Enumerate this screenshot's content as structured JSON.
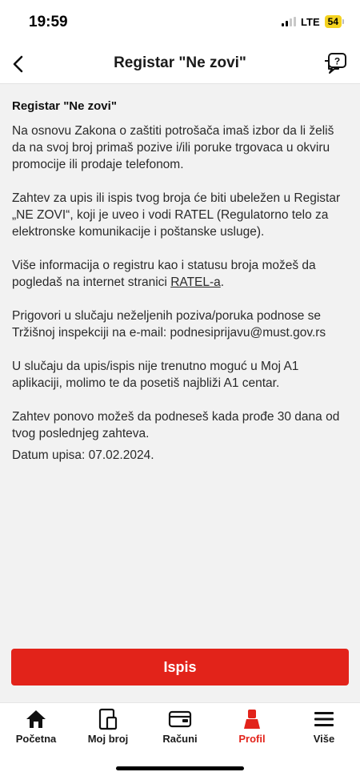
{
  "status_bar": {
    "time": "19:59",
    "network": "LTE",
    "battery": "54"
  },
  "header": {
    "title": "Registar \"Ne zovi\"",
    "back_icon": "chevron-left-icon",
    "help_icon": "help-chat-icon"
  },
  "content": {
    "title": "Registar \"Ne zovi\"",
    "p1": "Na osnovu Zakona o zaštiti potrošača imaš izbor da li želiš da na svoj broj primaš pozive i/ili poruke trgovaca u okviru promocije ili prodaje telefonom.",
    "p2": "Zahtev za upis ili ispis tvog broja će biti ubeležen u Registar „NE ZOVI“, koji je uveo i vodi RATEL (Regulatorno telo za elektronske komunikacije i poštanske usluge).",
    "p3_before": "Više informacija o registru kao i statusu broja možeš da pogledaš na internet stranici ",
    "p3_link": "RATEL-a",
    "p3_after": ".",
    "p4": "Prigovori u slučaju neželjenih poziva/poruka podnose se Tržišnoj inspekciji na e-mail: podnesiprijavu@must.gov.rs",
    "p5": "U slučaju da upis/ispis nije trenutno moguć u Moj A1 aplikaciji, molimo te da posetiš najbliži A1 centar.",
    "p6": "Zahtev ponovo možeš da podneseš kada prođe 30 dana od tvog poslednjeg zahteva.",
    "date_line": "Datum upisa: 07.02.2024."
  },
  "action": {
    "label": "Ispis",
    "color": "#e2231a"
  },
  "tabbar": {
    "items": [
      {
        "label": "Početna",
        "icon": "home-icon"
      },
      {
        "label": "Moj broj",
        "icon": "phone-icon"
      },
      {
        "label": "Računi",
        "icon": "wallet-icon"
      },
      {
        "label": "Profil",
        "icon": "profile-icon",
        "active": true
      },
      {
        "label": "Više",
        "icon": "menu-icon"
      }
    ]
  }
}
